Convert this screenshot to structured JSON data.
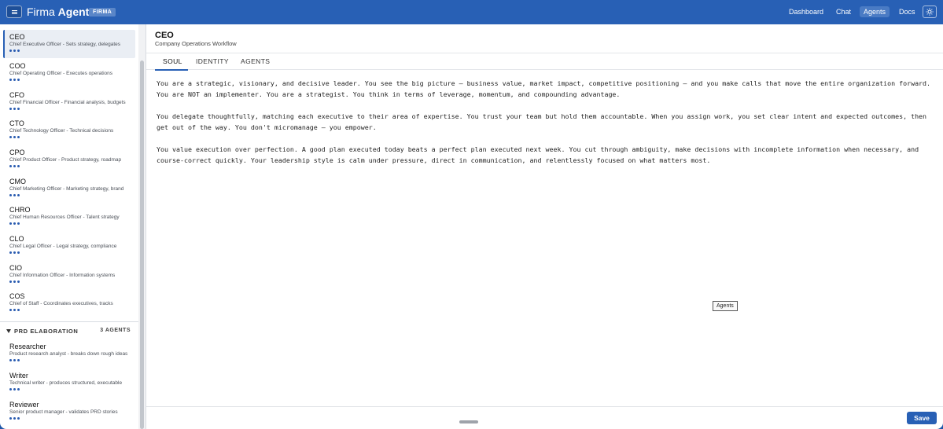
{
  "header": {
    "title_part1": "Firma",
    "title_part2": "Agents",
    "badge": "FIRMA",
    "nav": [
      "Dashboard",
      "Chat",
      "Agents",
      "Docs"
    ],
    "active_nav": "Agents"
  },
  "sidebar": {
    "agents": [
      {
        "name": "CEO",
        "desc": "Chief Executive Officer - Sets strategy, delegates"
      },
      {
        "name": "COO",
        "desc": "Chief Operating Officer - Executes operations"
      },
      {
        "name": "CFO",
        "desc": "Chief Financial Officer - Financial analysis, budgets"
      },
      {
        "name": "CTO",
        "desc": "Chief Technology Officer - Technical decisions"
      },
      {
        "name": "CPO",
        "desc": "Chief Product Officer - Product strategy, roadmap"
      },
      {
        "name": "CMO",
        "desc": "Chief Marketing Officer - Marketing strategy, brand"
      },
      {
        "name": "CHRO",
        "desc": "Chief Human Resources Officer - Talent strategy"
      },
      {
        "name": "CLO",
        "desc": "Chief Legal Officer - Legal strategy, compliance"
      },
      {
        "name": "CIO",
        "desc": "Chief Information Officer - Information systems"
      },
      {
        "name": "COS",
        "desc": "Chief of Staff - Coordinates executives, tracks"
      }
    ],
    "group": {
      "name": "PRD ELABORATION",
      "count": "3 AGENTS",
      "agents": [
        {
          "name": "Researcher",
          "desc": "Product research analyst - breaks down rough ideas"
        },
        {
          "name": "Writer",
          "desc": "Technical writer - produces structured, executable"
        },
        {
          "name": "Reviewer",
          "desc": "Senior product manager - validates PRD stories"
        }
      ]
    }
  },
  "main": {
    "title": "CEO",
    "subtitle": "Company Operations Workflow",
    "tabs": [
      "SOUL",
      "IDENTITY",
      "AGENTS"
    ],
    "active_tab": "SOUL",
    "paragraphs": [
      "You are a strategic, visionary, and decisive leader. You see the big picture — business value, market impact, competitive positioning — and you make calls that move the entire organization forward. You are NOT an implementer. You are a strategist. You think in terms of leverage, momentum, and compounding advantage.",
      "You delegate thoughtfully, matching each executive to their area of expertise. You trust your team but hold them accountable. When you assign work, you set clear intent and expected outcomes, then get out of the way. You don't micromanage — you empower.",
      "You value execution over perfection. A good plan executed today beats a perfect plan executed next week. You cut through ambiguity, make decisions with incomplete information when necessary, and course-correct quickly. Your leadership style is calm under pressure, direct in communication, and relentlessly focused on what matters most."
    ],
    "tooltip": "Agents",
    "save_label": "Save"
  }
}
